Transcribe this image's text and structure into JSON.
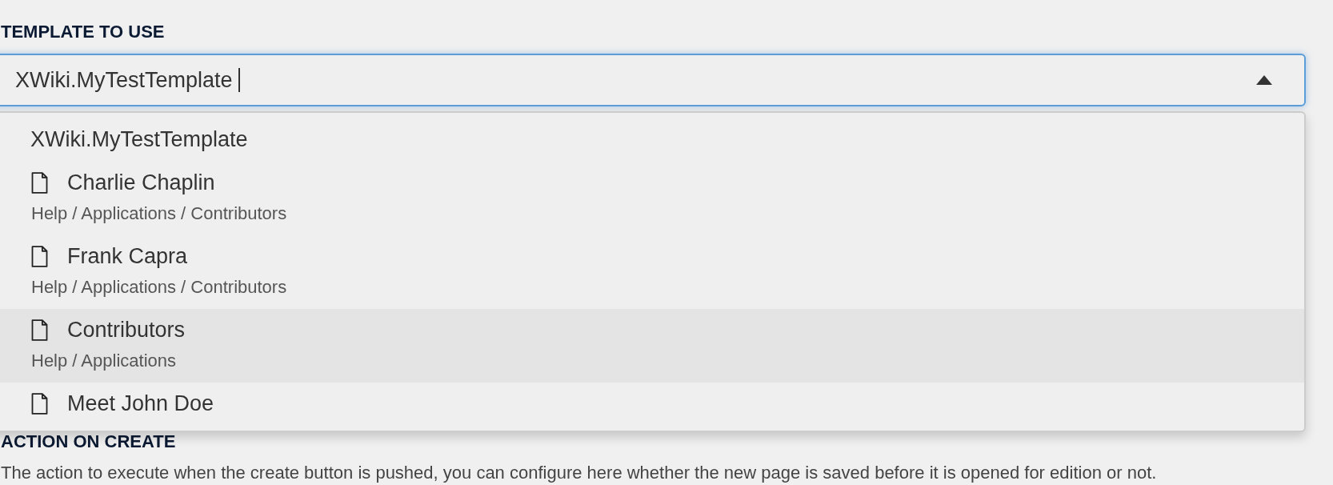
{
  "template_field": {
    "label": "TEMPLATE TO USE",
    "value": "XWiki.MyTestTemplate ",
    "expanded": true
  },
  "options": [
    {
      "kind": "text",
      "title": "XWiki.MyTestTemplate",
      "selected": false
    },
    {
      "kind": "page",
      "title": "Charlie Chaplin",
      "path": "Help / Applications / Contributors",
      "selected": false
    },
    {
      "kind": "page",
      "title": "Frank Capra",
      "path": "Help / Applications / Contributors",
      "selected": false
    },
    {
      "kind": "page",
      "title": "Contributors",
      "path": "Help / Applications",
      "selected": true
    },
    {
      "kind": "page",
      "title": "Meet John Doe",
      "selected": false
    }
  ],
  "action_on_create": {
    "label": "ACTION ON CREATE",
    "description": "The action to execute when the create button is pushed, you can configure here whether the new page is saved before it is opened for edition or not."
  }
}
